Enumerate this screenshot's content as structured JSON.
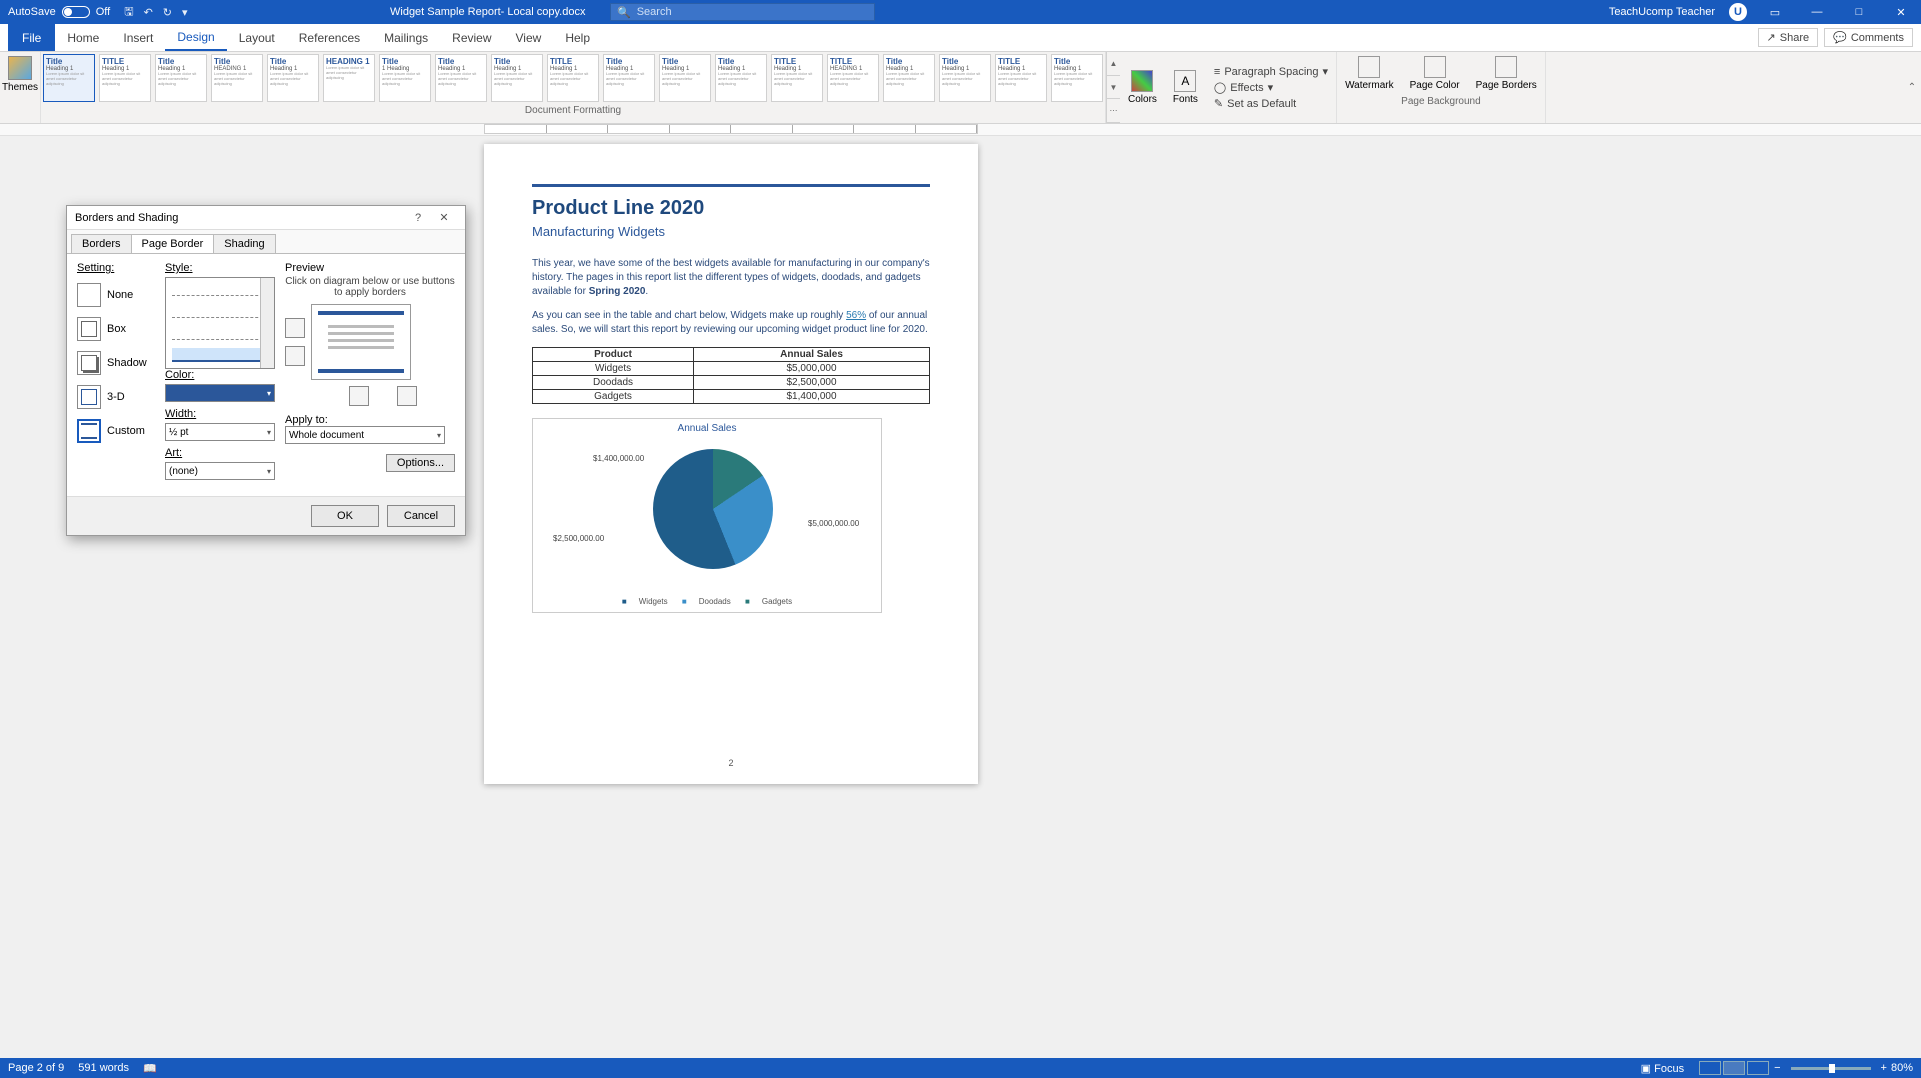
{
  "titlebar": {
    "autosave_label": "AutoSave",
    "autosave_state": "Off",
    "doc_title": "Widget Sample Report- Local copy.docx",
    "search_placeholder": "Search",
    "user": "TeachUcomp Teacher"
  },
  "ribbon": {
    "tabs": [
      "File",
      "Home",
      "Insert",
      "Design",
      "Layout",
      "References",
      "Mailings",
      "Review",
      "View",
      "Help"
    ],
    "active_tab": "Design",
    "share": "Share",
    "comments": "Comments",
    "themes": "Themes",
    "colors": "Colors",
    "fonts": "Fonts",
    "paragraph_spacing": "Paragraph Spacing",
    "effects": "Effects",
    "set_default": "Set as Default",
    "watermark": "Watermark",
    "page_color": "Page Color",
    "page_borders": "Page Borders",
    "group_docfmt": "Document Formatting",
    "group_pagebg": "Page Background",
    "style_thumbs": [
      {
        "title": "Title",
        "sub": "Heading 1"
      },
      {
        "title": "TITLE",
        "sub": "Heading 1"
      },
      {
        "title": "Title",
        "sub": "Heading 1"
      },
      {
        "title": "Title",
        "sub": "HEADING 1"
      },
      {
        "title": "Title",
        "sub": "Heading 1"
      },
      {
        "title": "HEADING 1",
        "sub": ""
      },
      {
        "title": "Title",
        "sub": "1 Heading"
      },
      {
        "title": "Title",
        "sub": "Heading 1"
      },
      {
        "title": "Title",
        "sub": "Heading 1"
      },
      {
        "title": "TITLE",
        "sub": "Heading 1"
      },
      {
        "title": "Title",
        "sub": "Heading 1"
      },
      {
        "title": "Title",
        "sub": "Heading 1"
      },
      {
        "title": "Title",
        "sub": "Heading 1"
      },
      {
        "title": "TITLE",
        "sub": "Heading 1"
      },
      {
        "title": "TITLE",
        "sub": "HEADING 1"
      },
      {
        "title": "Title",
        "sub": "Heading 1"
      },
      {
        "title": "Title",
        "sub": "Heading 1"
      },
      {
        "title": "TITLE",
        "sub": "Heading 1"
      },
      {
        "title": "Title",
        "sub": "Heading 1"
      }
    ]
  },
  "doc": {
    "h1": "Product Line 2020",
    "h2": "Manufacturing Widgets",
    "p1a": "This year, we have some of the best widgets available for manufacturing in our company's history. The pages in this report list the different types of widgets, doodads, and gadgets available for ",
    "p1b": "Spring 2020",
    "p1c": ".",
    "p2a": "As you can see in the table and chart below, Widgets make up roughly ",
    "p2link": "56%",
    "p2b": " of our annual sales. So, we will start this report by reviewing our upcoming widget product line for 2020.",
    "table": {
      "headers": [
        "Product",
        "Annual Sales"
      ],
      "rows": [
        [
          "Widgets",
          "$5,000,000"
        ],
        [
          "Doodads",
          "$2,500,000"
        ],
        [
          "Gadgets",
          "$1,400,000"
        ]
      ]
    },
    "chart_title": "Annual Sales",
    "chart_labels": {
      "d1": "$5,000,000.00",
      "d2": "$2,500,000.00",
      "d3": "$1,400,000.00"
    },
    "legend": {
      "a": "Widgets",
      "b": "Doodads",
      "c": "Gadgets"
    },
    "page_num": "2"
  },
  "chart_data": {
    "type": "pie",
    "title": "Annual Sales",
    "categories": [
      "Widgets",
      "Doodads",
      "Gadgets"
    ],
    "values": [
      5000000,
      2500000,
      1400000
    ],
    "data_labels": [
      "$5,000,000.00",
      "$2,500,000.00",
      "$1,400,000.00"
    ],
    "colors": [
      "#1f5d8a",
      "#3a8fc9",
      "#2a7a7a"
    ]
  },
  "dialog": {
    "title": "Borders and Shading",
    "tabs": [
      "Borders",
      "Page Border",
      "Shading"
    ],
    "active_tab": "Page Border",
    "setting_label": "Setting:",
    "settings": [
      "None",
      "Box",
      "Shadow",
      "3-D",
      "Custom"
    ],
    "style_label": "Style:",
    "color_label": "Color:",
    "width_label": "Width:",
    "width_value": "½ pt",
    "art_label": "Art:",
    "art_value": "(none)",
    "preview_label": "Preview",
    "preview_hint": "Click on diagram below or use buttons to apply borders",
    "applyto_label": "Apply to:",
    "applyto_value": "Whole document",
    "options_btn": "Options...",
    "ok": "OK",
    "cancel": "Cancel"
  },
  "statusbar": {
    "page": "Page 2 of 9",
    "words": "591 words",
    "focus": "Focus",
    "zoom": "80%"
  }
}
